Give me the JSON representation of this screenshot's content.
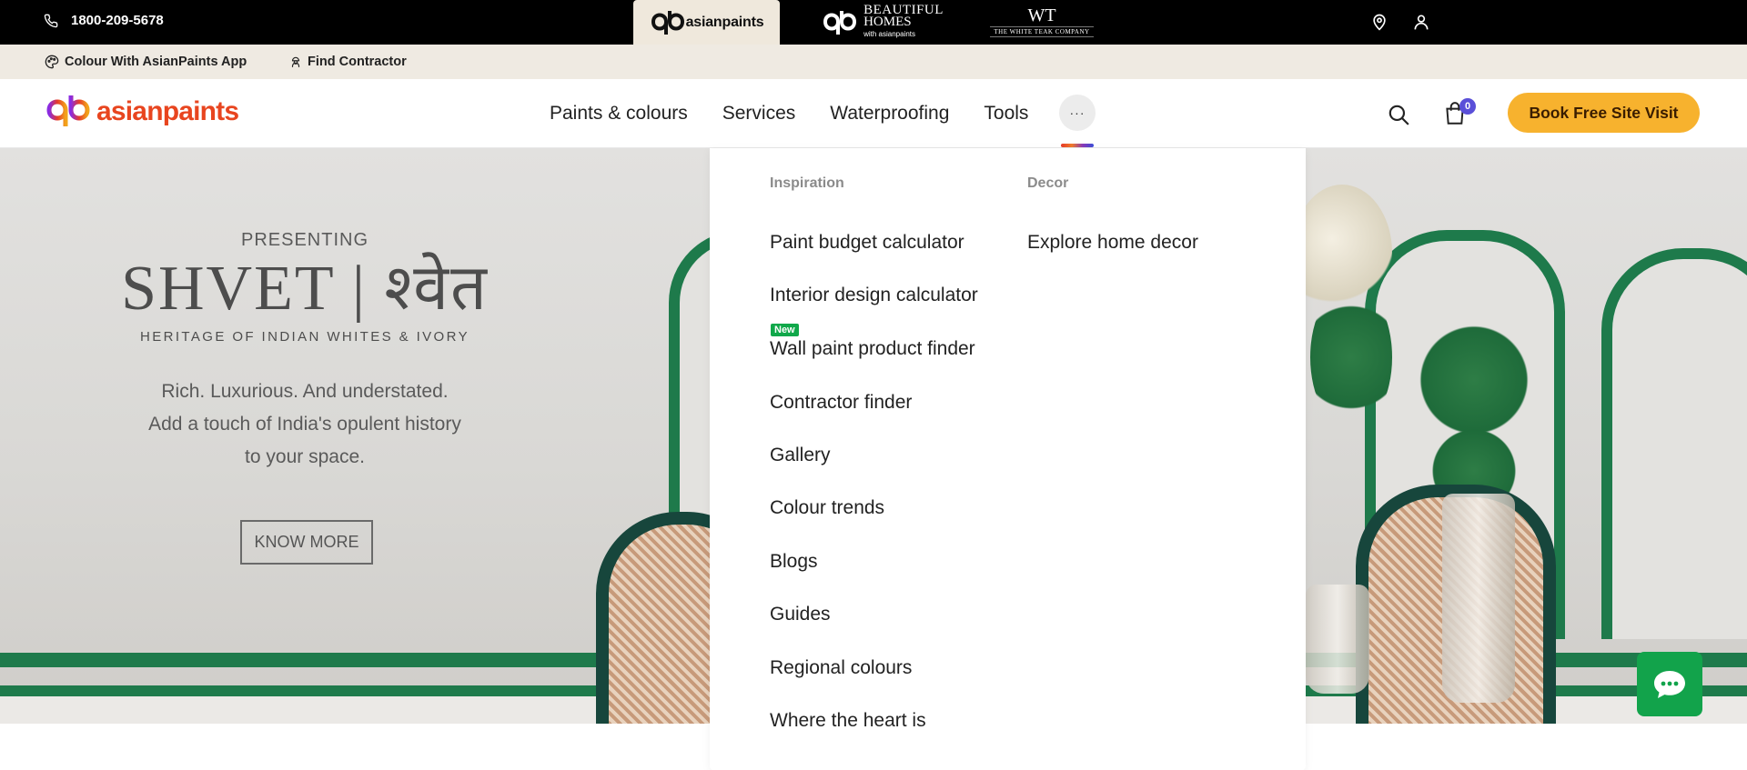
{
  "topbar": {
    "phone": "1800-209-5678",
    "brands": [
      "asianpaints",
      "BEAUTIFUL",
      "HOMES",
      "with asianpaints",
      "WT",
      "THE WHITE TEAK COMPANY"
    ]
  },
  "subbar": {
    "app_link": "Colour With AsianPaints App",
    "contractor_link": "Find Contractor"
  },
  "header": {
    "logo": "asianpaints",
    "nav": [
      "Paints & colours",
      "Services",
      "Waterproofing",
      "Tools"
    ],
    "more": "···",
    "cart_count": "0",
    "cta": "Book Free Site Visit"
  },
  "hero": {
    "presenting": "PRESENTING",
    "title": "SHVET | श्वेत",
    "subtitle": "HERITAGE OF INDIAN WHITES & IVORY",
    "desc": [
      "Rich. Luxurious. And understated.",
      "Add a touch of India's opulent history",
      "to your space."
    ],
    "button": "KNOW MORE"
  },
  "dropdown": {
    "col1_head": "Inspiration",
    "col2_head": "Decor",
    "new_badge": "New",
    "inspiration": [
      "Paint budget calculator",
      "Interior design calculator",
      "Wall paint product finder",
      "Contractor finder",
      "Gallery",
      "Colour trends",
      "Blogs",
      "Guides",
      "Regional colours",
      "Where the heart is"
    ],
    "decor": [
      "Explore home decor"
    ]
  },
  "colors": {
    "brand_orange": "#e8451f",
    "cta_yellow": "#f7b22e",
    "chat_green": "#12a34b",
    "badge_purple": "#5a4fd8"
  }
}
